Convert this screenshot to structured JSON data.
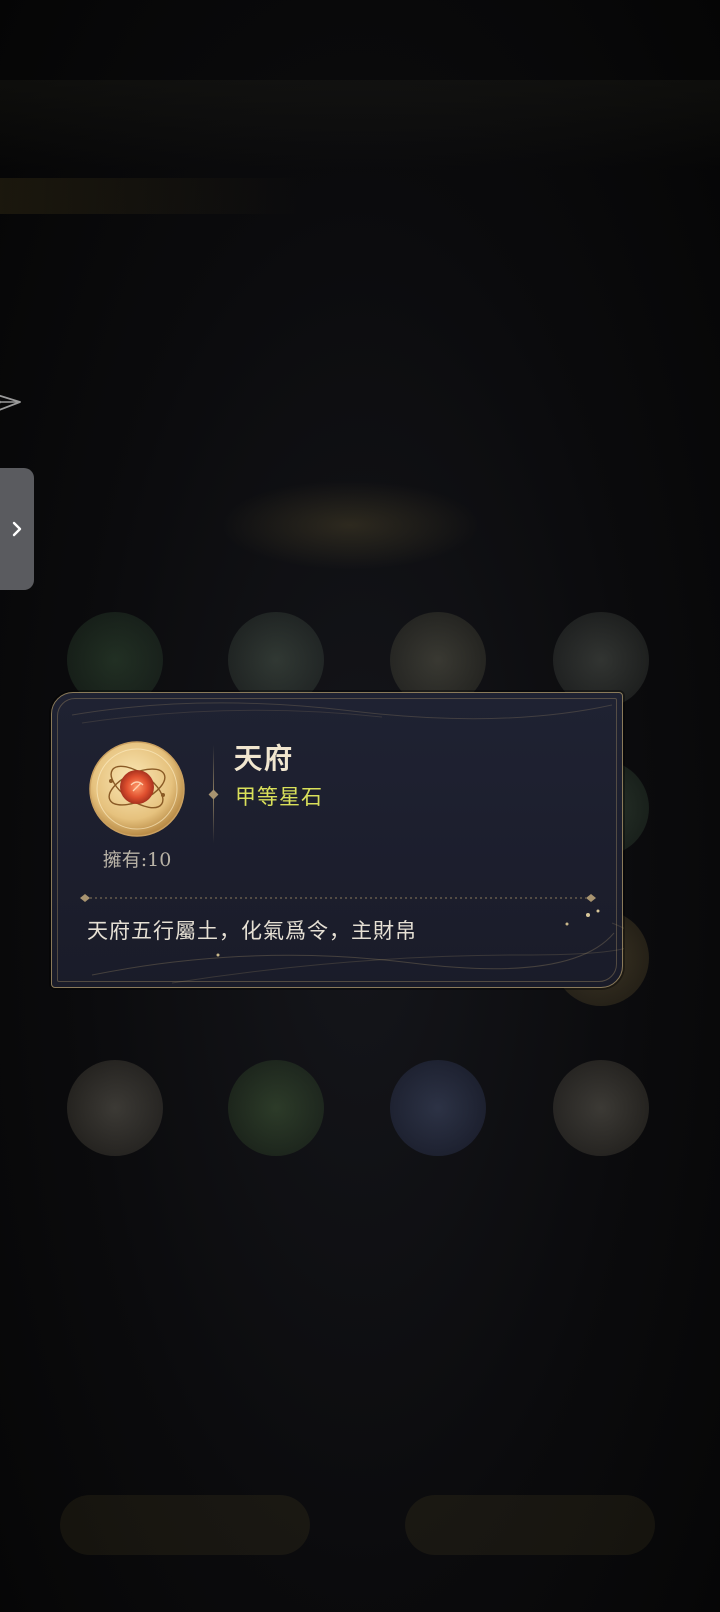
{
  "popup": {
    "item_name": "天府",
    "item_grade": "甲等星石",
    "owned_text": "擁有:10",
    "description": "天府五行屬土，化氣爲令，主財帛",
    "grade_color": "#d9e05a",
    "icon": "star-stone-icon"
  },
  "sidebar": {
    "expand_icon": "chevron-right-icon",
    "arrow_icon": "send-arrow-icon"
  }
}
